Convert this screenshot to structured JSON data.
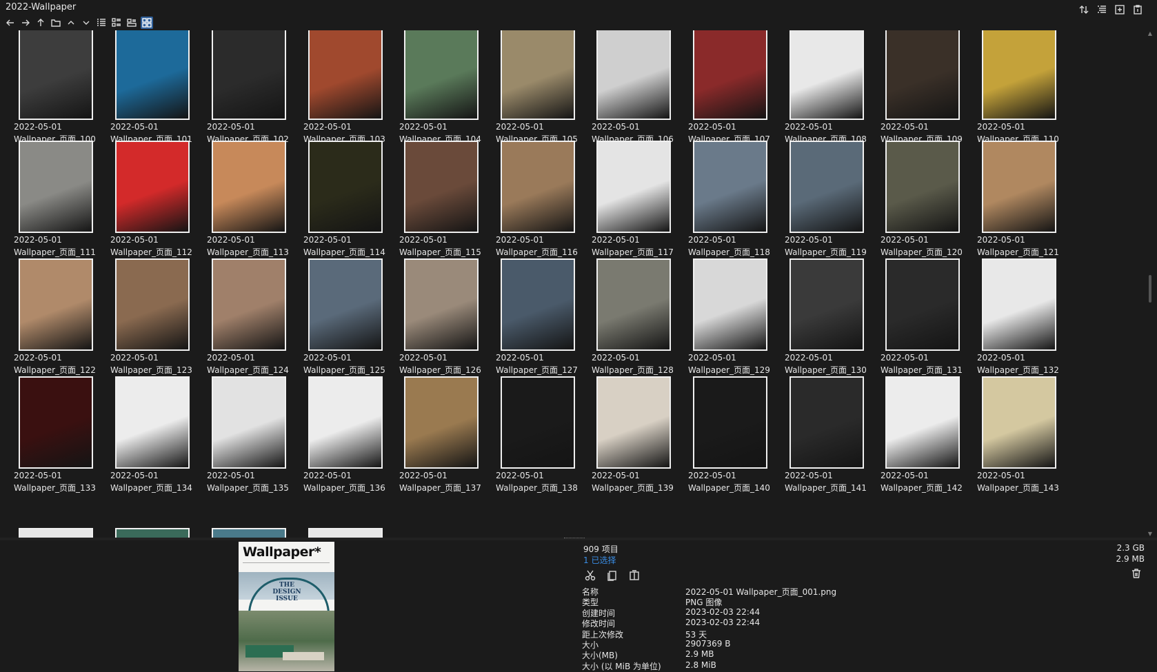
{
  "window": {
    "title": "2022-Wallpaper"
  },
  "toolbar": {
    "nav_icons": [
      "back-arrow-icon",
      "forward-arrow-icon",
      "up-arrow-icon",
      "folder-icon",
      "chevron-up-icon",
      "chevron-down-icon"
    ],
    "view_icons": [
      "details-view-icon",
      "list-view-icon",
      "tiles-view-icon",
      "thumbnails-view-icon"
    ],
    "active_view": "thumbnails-view-icon",
    "right_icons": [
      "sort-icon",
      "columns-icon",
      "new-window-icon",
      "clipboard-icon"
    ]
  },
  "files": {
    "date": "2022-05-01",
    "rows": [
      {
        "names": [
          "Wallpaper_页面_100",
          "Wallpaper_页面_101",
          "Wallpaper_页面_102",
          "Wallpaper_页面_103",
          "Wallpaper_页面_104",
          "Wallpaper_页面_105",
          "Wallpaper_页面_106",
          "Wallpaper_页面_107",
          "Wallpaper_页面_108",
          "Wallpaper_页面_109",
          "Wallpaper_页面_110"
        ],
        "colors": [
          "#3d3d3d",
          "#1d6a9a",
          "#2b2b2b",
          "#a0492e",
          "#5a7a5a",
          "#9a8a6a",
          "#cfcfcf",
          "#8a2a2a",
          "#e8e8e8",
          "#3a3028",
          "#c4a23a"
        ]
      },
      {
        "names": [
          "Wallpaper_页面_111",
          "Wallpaper_页面_112",
          "Wallpaper_页面_113",
          "Wallpaper_页面_114",
          "Wallpaper_页面_115",
          "Wallpaper_页面_116",
          "Wallpaper_页面_117",
          "Wallpaper_页面_118",
          "Wallpaper_页面_119",
          "Wallpaper_页面_120",
          "Wallpaper_页面_121"
        ],
        "colors": [
          "#8a8a86",
          "#d32a2a",
          "#c7895a",
          "#2b2b1a",
          "#6a4a3a",
          "#9a7a5a",
          "#e4e4e4",
          "#6a7a8a",
          "#5a6a78",
          "#5a5a4a",
          "#b08860"
        ]
      },
      {
        "names": [
          "Wallpaper_页面_122",
          "Wallpaper_页面_123",
          "Wallpaper_页面_124",
          "Wallpaper_页面_125",
          "Wallpaper_页面_126",
          "Wallpaper_页面_127",
          "Wallpaper_页面_128",
          "Wallpaper_页面_129",
          "Wallpaper_页面_130",
          "Wallpaper_页面_131",
          "Wallpaper_页面_132"
        ],
        "colors": [
          "#b08a6a",
          "#8a6a50",
          "#a0806a",
          "#5a6a7a",
          "#9a8a7a",
          "#4a5a6a",
          "#7a7a70",
          "#d8d8d8",
          "#3a3a3a",
          "#2a2a2a",
          "#e8e8e8"
        ]
      },
      {
        "names": [
          "Wallpaper_页面_133",
          "Wallpaper_页面_134",
          "Wallpaper_页面_135",
          "Wallpaper_页面_136",
          "Wallpaper_页面_137",
          "Wallpaper_页面_138",
          "Wallpaper_页面_139",
          "Wallpaper_页面_140",
          "Wallpaper_页面_141",
          "Wallpaper_页面_142",
          "Wallpaper_页面_143"
        ],
        "colors": [
          "#3a1010",
          "#ececec",
          "#e2e2e2",
          "#ececec",
          "#9a7a50",
          "#1a1a1a",
          "#d8d0c4",
          "#1a1a1a",
          "#2a2a2a",
          "#ececec",
          "#d4c8a0"
        ]
      }
    ],
    "partial_row_colors": [
      "#e8e8e8",
      "#3a6a5a",
      "#4a7a8a",
      "#e8e8e8"
    ]
  },
  "preview": {
    "logo_text": "Wallpaper*",
    "issue_text": "THE DESIGN ISSUE"
  },
  "status": {
    "count": "909 项目",
    "selected": "1 已选择",
    "total_size": "2.3 GB",
    "selected_size": "2.9 MB",
    "action_icons": [
      "cut-icon",
      "copy-icon",
      "paste-icon"
    ]
  },
  "properties": [
    {
      "key": "名称",
      "value": "2022-05-01 Wallpaper_页面_001.png"
    },
    {
      "key": "类型",
      "value": "PNG 图像"
    },
    {
      "key": "创建时间",
      "value": "2023-02-03  22:44"
    },
    {
      "key": "修改时间",
      "value": "2023-02-03  22:44"
    },
    {
      "key": "距上次修改",
      "value": "53 天"
    },
    {
      "key": "大小",
      "value": "2907369 B"
    },
    {
      "key": "大小(MB)",
      "value": "2.9 MB"
    },
    {
      "key": "大小 (以 MiB 为单位)",
      "value": "2.8 MiB"
    }
  ]
}
